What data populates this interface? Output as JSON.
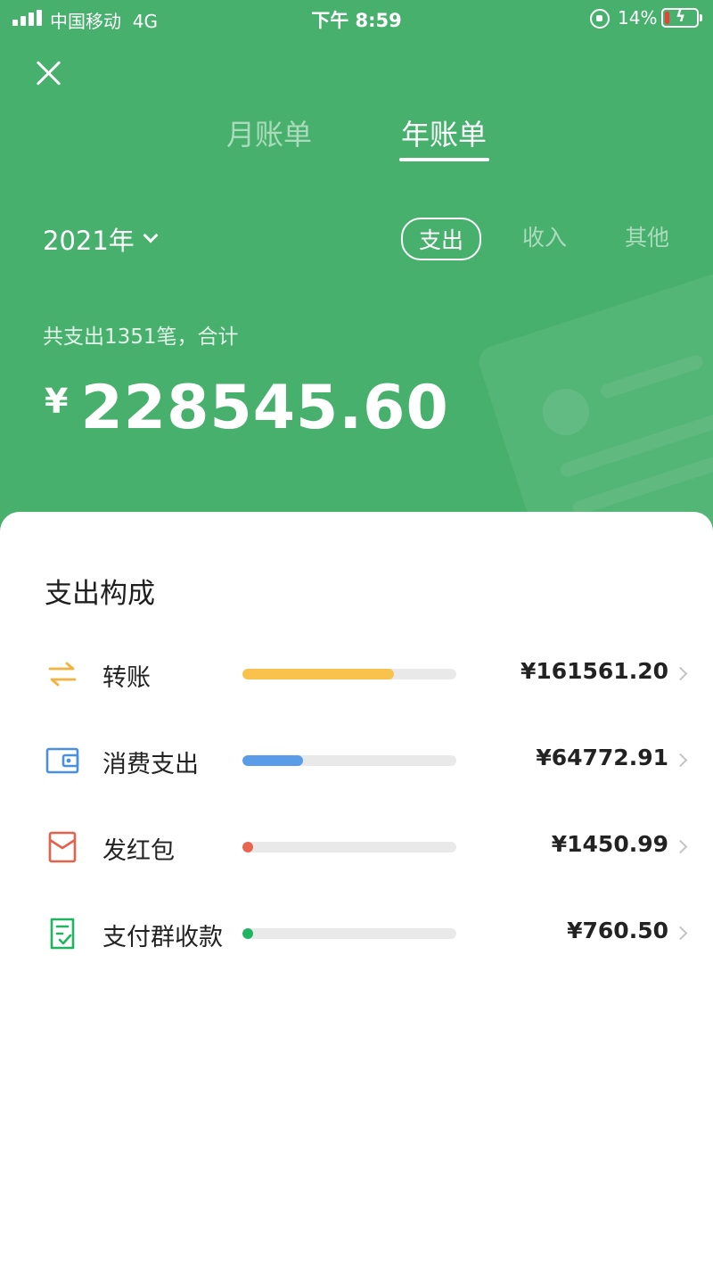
{
  "status_bar": {
    "carrier": "中国移动",
    "network": "4G",
    "time": "下午 8:59",
    "battery": "14%"
  },
  "tabs": [
    {
      "label": "月账单",
      "active": false
    },
    {
      "label": "年账单",
      "active": true
    }
  ],
  "year_select": "2021年",
  "filters": [
    {
      "label": "支出",
      "active": true
    },
    {
      "label": "收入",
      "active": false
    },
    {
      "label": "其他",
      "active": false
    }
  ],
  "summary_text": "共支出1351笔，合计",
  "total": {
    "currency": "¥",
    "amount": "228545.60"
  },
  "colors": {
    "header_bg": "#46b06c"
  },
  "breakdown": {
    "title": "支出构成",
    "items": [
      {
        "label": "转账",
        "amount": "¥161561.20",
        "fraction": 0.707,
        "color": "#f9c24c",
        "icon": "transfer-icon"
      },
      {
        "label": "消费支出",
        "amount": "¥64772.91",
        "fraction": 0.283,
        "color": "#5a9ce8",
        "icon": "wallet-icon"
      },
      {
        "label": "发红包",
        "amount": "¥1450.99",
        "fraction": 0.006,
        "color": "#e8654f",
        "icon": "red-envelope-icon"
      },
      {
        "label": "支付群收款",
        "amount": "¥760.50",
        "fraction": 0.003,
        "color": "#1fb45f",
        "icon": "group-payment-icon"
      }
    ]
  }
}
